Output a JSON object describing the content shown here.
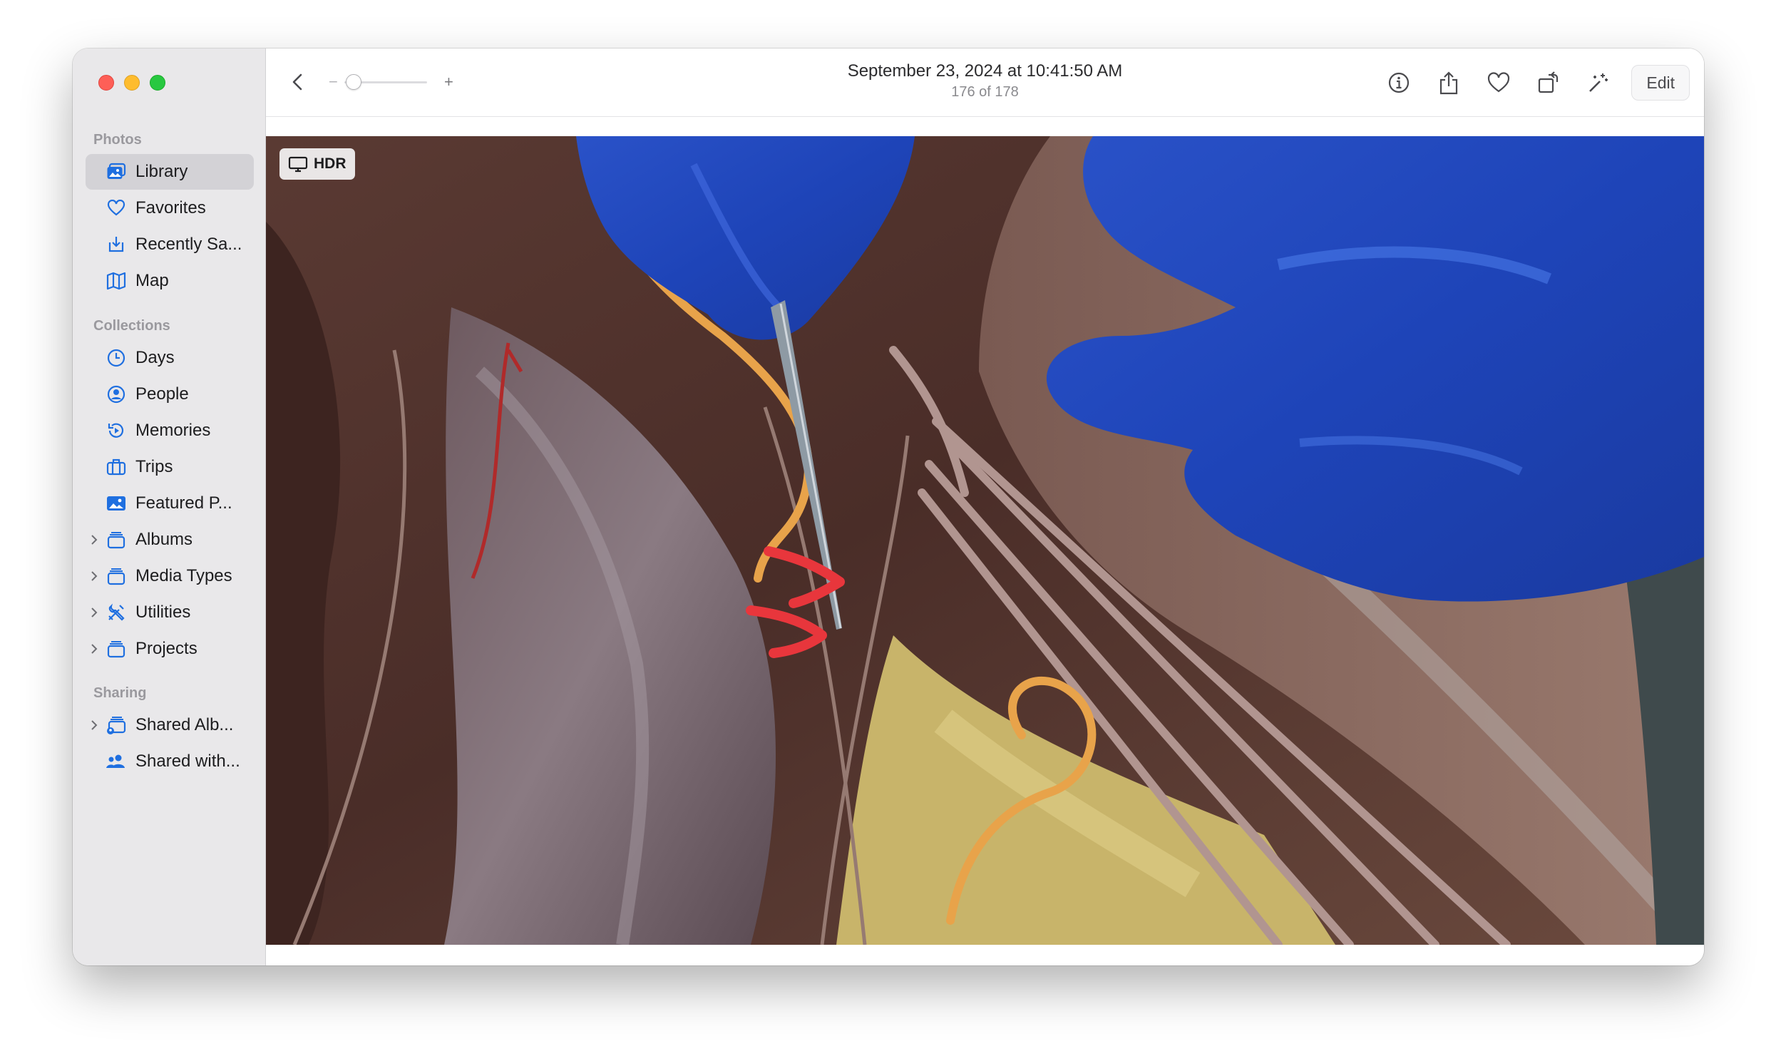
{
  "sidebar": {
    "sections": {
      "photos": "Photos",
      "collections": "Collections",
      "sharing": "Sharing"
    },
    "items": [
      {
        "label": "Library",
        "icon": "library-icon"
      },
      {
        "label": "Favorites",
        "icon": "heart-icon"
      },
      {
        "label": "Recently Sa...",
        "icon": "download-tray-icon"
      },
      {
        "label": "Map",
        "icon": "map-icon"
      },
      {
        "label": "Days",
        "icon": "clock-icon"
      },
      {
        "label": "People",
        "icon": "person-circle-icon"
      },
      {
        "label": "Memories",
        "icon": "memories-icon"
      },
      {
        "label": "Trips",
        "icon": "suitcase-icon"
      },
      {
        "label": "Featured P...",
        "icon": "photo-icon"
      },
      {
        "label": "Albums",
        "icon": "album-stack-icon"
      },
      {
        "label": "Media Types",
        "icon": "album-stack-icon"
      },
      {
        "label": "Utilities",
        "icon": "tools-icon"
      },
      {
        "label": "Projects",
        "icon": "album-stack-icon"
      },
      {
        "label": "Shared Alb...",
        "icon": "shared-album-icon"
      },
      {
        "label": "Shared with...",
        "icon": "people-icon"
      }
    ]
  },
  "toolbar": {
    "date": "September 23, 2024 at 10:41:50 AM",
    "count": "176 of 178",
    "zoom_minus": "−",
    "zoom_plus": "+",
    "edit_label": "Edit",
    "icons": [
      "info-icon",
      "share-icon",
      "heart-icon",
      "rotate-icon",
      "magic-wand-icon"
    ]
  },
  "photo": {
    "badge": "HDR"
  },
  "colors": {
    "accent": "#1f6fe0",
    "sidebar_bg": "#e9e8ea",
    "selected_bg": "#d3d2d6"
  }
}
